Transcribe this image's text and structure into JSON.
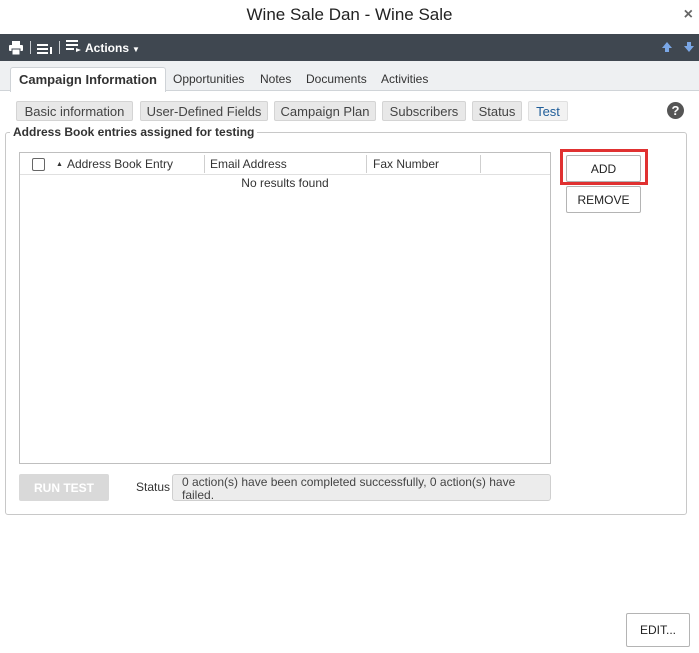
{
  "window": {
    "title": "Wine Sale Dan - Wine Sale",
    "close_glyph": "×"
  },
  "toolbar": {
    "actions_label": "Actions",
    "icons": [
      "printer-icon",
      "list-icon",
      "actions-list-icon",
      "move-up-icon",
      "move-down-icon"
    ]
  },
  "tabs": [
    {
      "label": "Campaign Information",
      "active": true
    },
    {
      "label": "Opportunities"
    },
    {
      "label": "Notes"
    },
    {
      "label": "Documents"
    },
    {
      "label": "Activities"
    }
  ],
  "subtabs": [
    {
      "label": "Basic information"
    },
    {
      "label": "User-Defined Fields"
    },
    {
      "label": "Campaign Plan"
    },
    {
      "label": "Subscribers"
    },
    {
      "label": "Status"
    },
    {
      "label": "Test",
      "selected": true
    }
  ],
  "help_glyph": "?",
  "group": {
    "legend": "Address Book entries assigned for testing",
    "columns": [
      "Address Book Entry",
      "Email Address",
      "Fax Number"
    ],
    "empty_text": "No results found",
    "add_label": "ADD",
    "remove_label": "REMOVE"
  },
  "footer": {
    "run_test_label": "RUN TEST",
    "status_label": "Status",
    "status_text": "0 action(s) have been completed successfully, 0 action(s) have failed.",
    "edit_label": "EDIT..."
  },
  "colors": {
    "toolbar_bg": "#3f4750",
    "highlight": "#e03131",
    "selected_subtab_text": "#1f5d99"
  }
}
